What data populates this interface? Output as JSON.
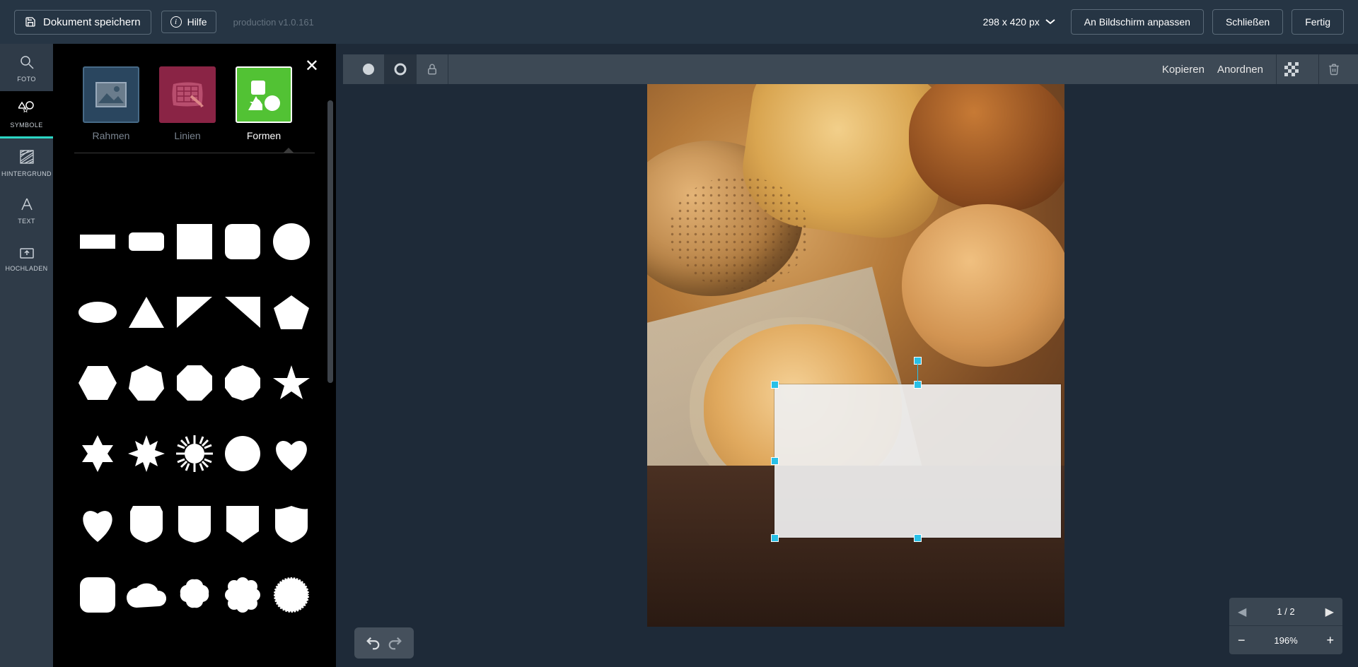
{
  "topbar": {
    "save": "Dokument speichern",
    "help": "Hilfe",
    "version": "production v1.0.161",
    "dimensions": "298 x 420 px",
    "fit": "An Bildschirm anpassen",
    "close": "Schließen",
    "done": "Fertig"
  },
  "rail": {
    "foto": "FOTO",
    "symbole": "SYMBOLE",
    "hintergrund": "HINTERGRUND",
    "text": "TEXT",
    "hochladen": "HOCHLADEN"
  },
  "panel": {
    "cat_rahmen": "Rahmen",
    "cat_linien": "Linien",
    "cat_formen": "Formen"
  },
  "worktools": {
    "copy": "Kopieren",
    "arrange": "Anordnen"
  },
  "pager": {
    "page": "1 / 2",
    "zoom": "196%"
  }
}
